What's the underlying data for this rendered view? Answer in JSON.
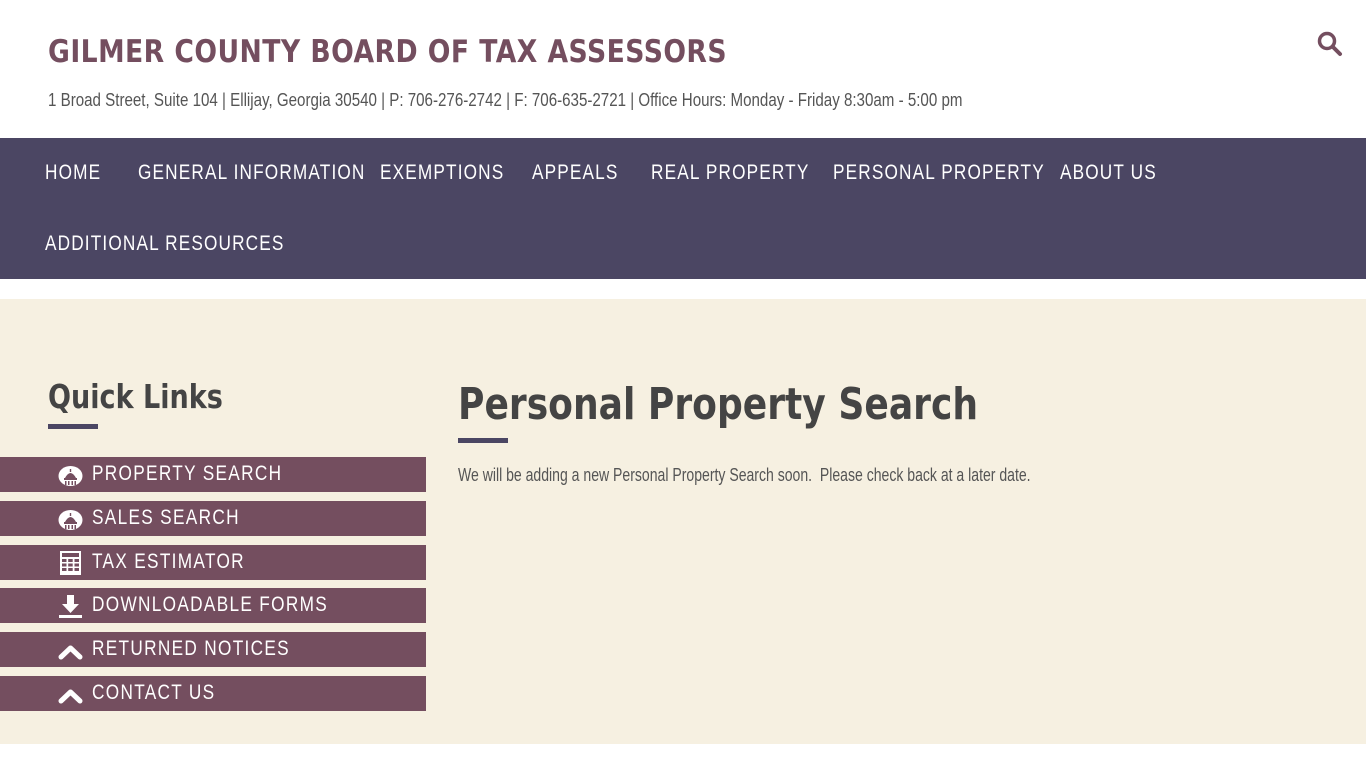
{
  "header": {
    "site_title": "GILMER COUNTY BOARD OF TAX ASSESSORS",
    "site_info": "1 Broad Street, Suite 104  |  Ellijay, Georgia 30540  |  P: 706-276-2742 | F: 706-635-2721  |  Office Hours: Monday - Friday 8:30am - 5:00 pm",
    "search_icon": "search-icon",
    "accent_color": "#744e5f"
  },
  "nav": {
    "background_color": "#4b4663",
    "items": [
      {
        "label": "HOME"
      },
      {
        "label": "GENERAL INFORMATION"
      },
      {
        "label": "EXEMPTIONS"
      },
      {
        "label": "APPEALS"
      },
      {
        "label": "REAL PROPERTY"
      },
      {
        "label": "PERSONAL PROPERTY"
      },
      {
        "label": "ABOUT US"
      },
      {
        "label": "ADDITIONAL RESOURCES"
      }
    ]
  },
  "sidebar": {
    "title": "Quick Links",
    "items": [
      {
        "label": "PROPERTY SEARCH",
        "icon": "courthouse-icon"
      },
      {
        "label": "SALES SEARCH",
        "icon": "courthouse-icon"
      },
      {
        "label": "TAX ESTIMATOR",
        "icon": "calculator-grid-icon"
      },
      {
        "label": "DOWNLOADABLE FORMS",
        "icon": "download-icon"
      },
      {
        "label": "RETURNED NOTICES",
        "icon": "chevron-up-icon"
      },
      {
        "label": "CONTACT US",
        "icon": "chevron-up-icon"
      }
    ]
  },
  "main": {
    "title": "Personal Property Search",
    "body": "We will be adding a new Personal Property Search soon.  Please check back at a later date."
  }
}
